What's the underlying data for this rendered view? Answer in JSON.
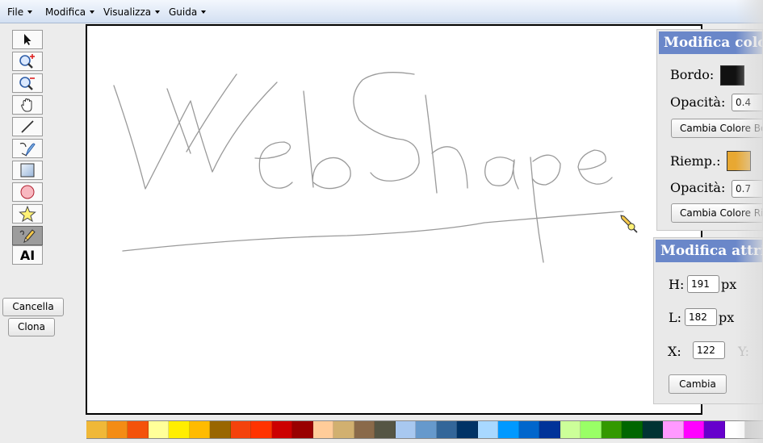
{
  "menubar": {
    "items": [
      {
        "label": "File"
      },
      {
        "label": "Modifica"
      },
      {
        "label": "Visualizza"
      },
      {
        "label": "Guida"
      }
    ]
  },
  "toolbar": {
    "tools": [
      {
        "name": "select-tool",
        "icon": "arrow-pointer-icon"
      },
      {
        "name": "zoom-in-tool",
        "icon": "zoom-in-icon"
      },
      {
        "name": "zoom-out-tool",
        "icon": "zoom-out-icon"
      },
      {
        "name": "pan-tool",
        "icon": "hand-icon"
      },
      {
        "name": "line-tool",
        "icon": "line-icon"
      },
      {
        "name": "path-tool",
        "icon": "pen-path-icon"
      },
      {
        "name": "rectangle-tool",
        "icon": "rectangle-icon"
      },
      {
        "name": "ellipse-tool",
        "icon": "ellipse-icon"
      },
      {
        "name": "star-tool",
        "icon": "star-icon"
      },
      {
        "name": "freehand-tool",
        "icon": "pencil-icon",
        "active": true
      },
      {
        "name": "text-tool",
        "icon": "text-icon",
        "label": "AI"
      }
    ],
    "delete_label": "Cancella",
    "clone_label": "Clona"
  },
  "color_panel": {
    "title": "Modifica colore",
    "border_label": "Bordo:",
    "border_color": "#111111",
    "border_opacity_label": "Opacità:",
    "border_opacity_value": "0.4",
    "change_border_color_label": "Cambia Colore Bordo",
    "fill_label": "Riemp.:",
    "fill_color": "#e8a832",
    "fill_opacity_label": "Opacità:",
    "fill_opacity_value": "0.7",
    "change_fill_color_label": "Cambia Colore Riemp."
  },
  "attr_panel": {
    "title": "Modifica attributi",
    "h_label": "H:",
    "h_value": "191",
    "w_label": "L:",
    "w_value": "182",
    "x_label": "X:",
    "x_value": "122",
    "y_label": "Y:",
    "unit": "px",
    "apply_label": "Cambia"
  },
  "palette": {
    "colors": [
      "#f0b838",
      "#f48c14",
      "#f4520a",
      "#ffff99",
      "#ffee00",
      "#ffbb00",
      "#996600",
      "#f4420c",
      "#ff3300",
      "#cc0000",
      "#990000",
      "#ffcc99",
      "#d1b070",
      "#8a6a4a",
      "#555544",
      "#a8c8f0",
      "#6699cc",
      "#336699",
      "#003366",
      "#a8d8ff",
      "#0099ff",
      "#0066cc",
      "#003399",
      "#ccff99",
      "#99ff66",
      "#339900",
      "#006600",
      "#003333",
      "#ff99ff",
      "#ff00ff",
      "#6600cc",
      "#ffffff",
      "#cccccc"
    ]
  },
  "canvas": {
    "stroke_color": "#999999"
  }
}
